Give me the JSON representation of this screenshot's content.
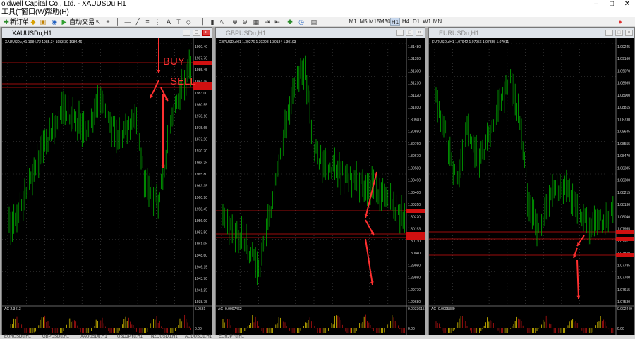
{
  "app": {
    "title": "oldwell Capital Co., Ltd. - XAUUSDu,H1",
    "menu": [
      "工具(T)",
      "窗口(W)",
      "帮助(H)"
    ],
    "toolbar_new_order": "新订单",
    "toolbar_auto_trade": "自动交易",
    "timeframes": [
      "M1",
      "M5",
      "M15",
      "M30",
      "H1",
      "H4",
      "D1",
      "W1",
      "MN"
    ],
    "active_timeframe": "H1",
    "bottom_tabs": [
      "EURUSDu,H1",
      "GBPUSDu,H1",
      "XAUUSDu,H1",
      "USDJPYu,H1",
      "NZDUSDu,H1",
      "AUDUSDu,H1",
      "EURJPYu,H1"
    ]
  },
  "windows": [
    {
      "title": "XAUUSDu,H1",
      "header": "XAUUSDu,H1  1984.72 1985.34 1983.30 1984.46",
      "price_labels": [
        "1990.40",
        "1987.70",
        "1985.45",
        "1984.46",
        "1983.00",
        "1980.55",
        "1978.10",
        "1975.65",
        "1973.20",
        "1970.70",
        "1968.25",
        "1965.80",
        "1963.35",
        "1960.90",
        "1958.45",
        "1956.00",
        "1953.50",
        "1951.05",
        "1948.60",
        "1946.15",
        "1943.70",
        "1941.25",
        "1938.75"
      ],
      "ac_label": "AC 2.3413",
      "ac_max": "5.9531",
      "ac_zero": "0.00",
      "annotations": {
        "buy": "BUY",
        "sell": "SELL"
      }
    },
    {
      "title": "GBPUSDu,H1",
      "header": "GBPUSDu,H1  1.30276 1.30298 1.30184 1.30193",
      "price_labels": [
        "1.31480",
        "1.31390",
        "1.31300",
        "1.31210",
        "1.31120",
        "1.31030",
        "1.30940",
        "1.30850",
        "1.30760",
        "1.30670",
        "1.30580",
        "1.30490",
        "1.30400",
        "1.30310",
        "1.30220",
        "1.30193",
        "1.30130",
        "1.30040",
        "1.29950",
        "1.29860",
        "1.29770",
        "1.29680"
      ],
      "ac_label": "AC -0.0007462",
      "ac_max": "0.0033615",
      "ac_zero": "0.00"
    },
    {
      "title": "EURUSDu,H1",
      "header": "EURUSDu,H1  1.07942 1.07956 1.07885 1.07911",
      "price_labels": [
        "1.09245",
        "1.09160",
        "1.09070",
        "1.08985",
        "1.08900",
        "1.08815",
        "1.08730",
        "1.08645",
        "1.08555",
        "1.08470",
        "1.08385",
        "1.08300",
        "1.08215",
        "1.08130",
        "1.08040",
        "1.07955",
        "1.07911",
        "1.07870",
        "1.07785",
        "1.07700",
        "1.07615",
        "1.07530"
      ],
      "ac_label": "AC -0.0005389",
      "ac_max": "0.002449",
      "ac_zero": "0.00"
    }
  ],
  "colors": {
    "candle": "#00a000",
    "grid": "#4a4a4a",
    "level": "#d01010",
    "arrow": "#ff3030",
    "ac_up": "#c8b400",
    "ac_down": "#a01010"
  }
}
